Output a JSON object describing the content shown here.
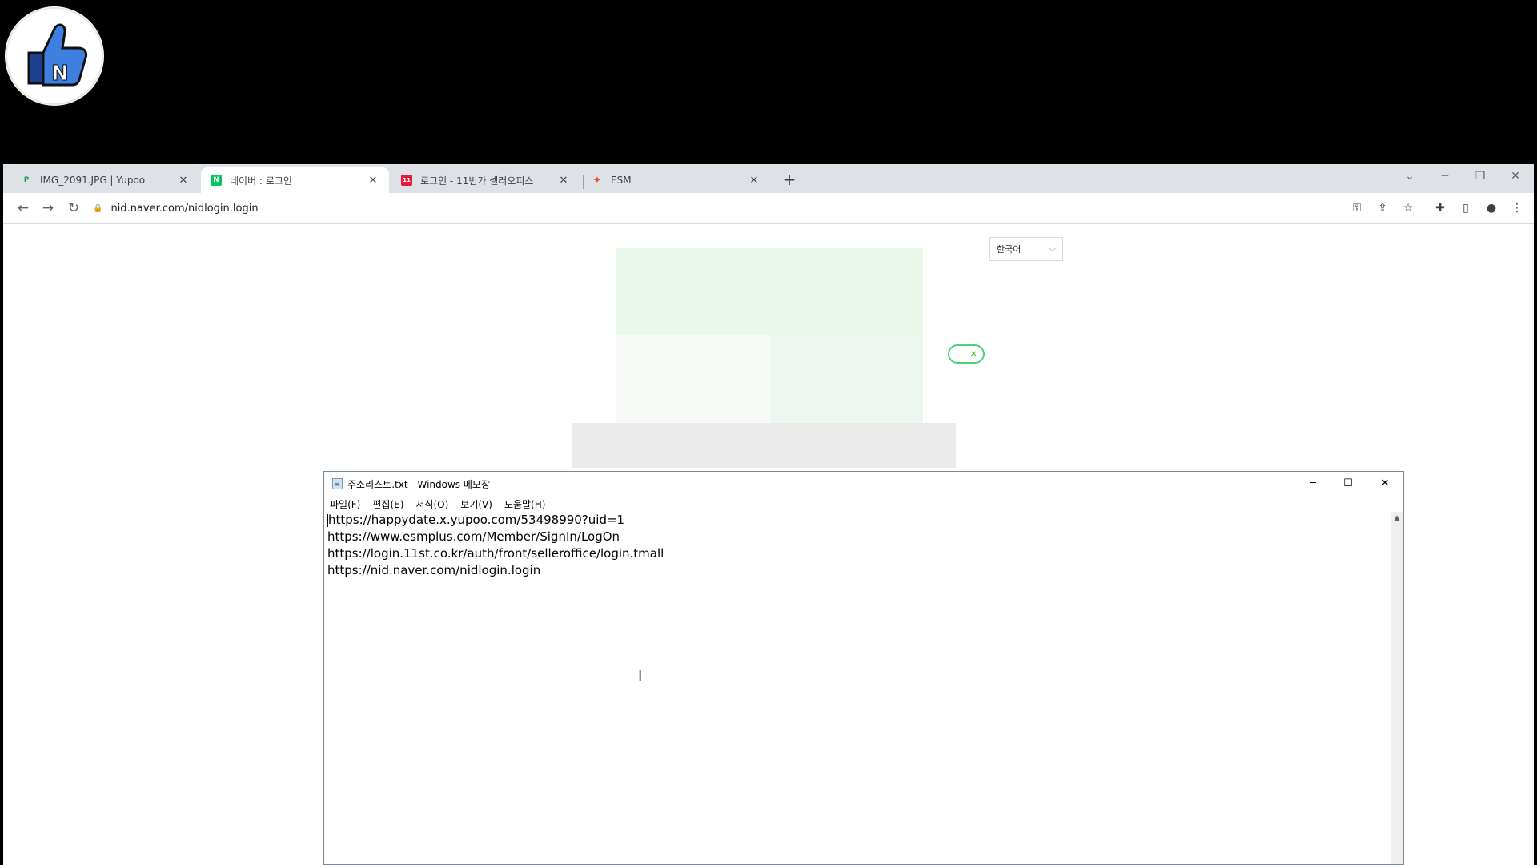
{
  "browser": {
    "tabs": [
      {
        "title": "IMG_2091.JPG | Yupoo",
        "favicon": "yupoo-icon",
        "active": false
      },
      {
        "title": "네이버 : 로그인",
        "favicon": "naver-icon",
        "active": true
      },
      {
        "title": "로그인 - 11번가 셀러오피스",
        "favicon": "11st-icon",
        "active": false
      },
      {
        "title": "ESM",
        "favicon": "esm-icon",
        "active": false
      }
    ],
    "new_tab": "+",
    "address": "nid.naver.com/nidlogin.login"
  },
  "page": {
    "language_select": "한국어"
  },
  "notepad": {
    "title": "주소리스트.txt - Windows 메모장",
    "menu": [
      "파일(F)",
      "편집(E)",
      "서식(O)",
      "보기(V)",
      "도움말(H)"
    ],
    "lines": [
      "https://happydate.x.yupoo.com/53498990?uid=1",
      "https://www.esmplus.com/Member/SignIn/LogOn",
      "https://login.11st.co.kr/auth/front/selleroffice/login.tmall",
      "https://nid.naver.com/nidlogin.login"
    ]
  },
  "colors": {
    "naver_green": "#03c75a",
    "tabstrip": "#dee1e6",
    "logo_blue": "#2f6fd6"
  }
}
